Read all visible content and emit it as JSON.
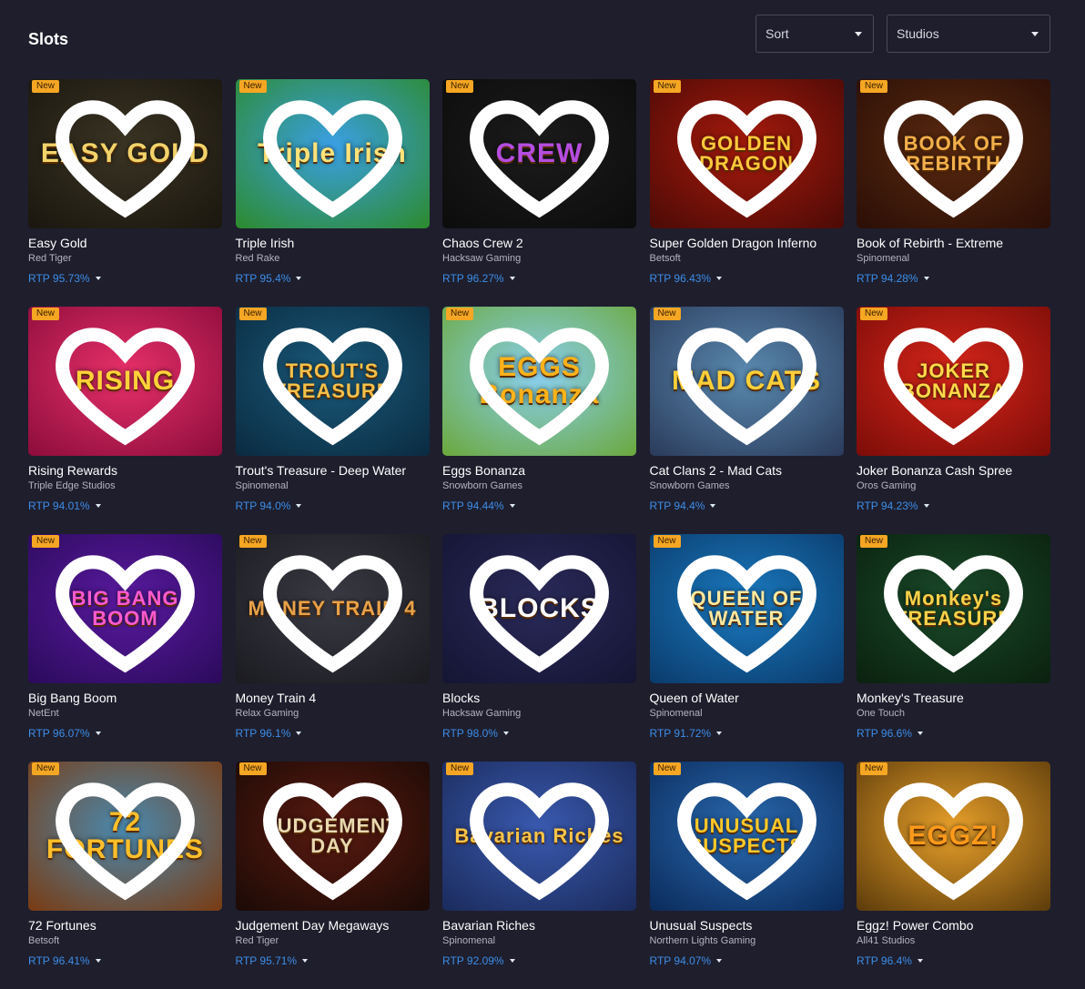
{
  "page": {
    "title": "Slots"
  },
  "filters": {
    "sort_label": "Sort",
    "studios_label": "Studios"
  },
  "badge_label": "New",
  "games": [
    {
      "name": "Easy Gold",
      "provider": "Red Tiger",
      "rtp": "RTP 95.73%",
      "new": true,
      "art": "EASY GOLD",
      "bg": [
        "#3a3424",
        "#1a160e"
      ],
      "art_color": "#f2d36b"
    },
    {
      "name": "Triple Irish",
      "provider": "Red Rake",
      "rtp": "RTP 95.4%",
      "new": true,
      "art": "Triple Irish",
      "bg": [
        "#3aa0e6",
        "#2c8a2a"
      ],
      "art_color": "#ffe27a"
    },
    {
      "name": "Chaos Crew 2",
      "provider": "Hacksaw Gaming",
      "rtp": "RTP 96.27%",
      "new": true,
      "art": "CREW",
      "bg": [
        "#1b1b1b",
        "#0c0c0c"
      ],
      "art_color": "#b54de0"
    },
    {
      "name": "Super Golden Dragon Inferno",
      "provider": "Betsoft",
      "rtp": "RTP 96.43%",
      "new": true,
      "art": "GOLDEN DRAGON",
      "bg": [
        "#a81a0c",
        "#4a0a06"
      ],
      "art_color": "#ffc83a"
    },
    {
      "name": "Book of Rebirth - Extreme",
      "provider": "Spinomenal",
      "rtp": "RTP 94.28%",
      "new": true,
      "art": "BOOK OF REBIRTH",
      "bg": [
        "#5a2a10",
        "#2a0e06"
      ],
      "art_color": "#f2b04a"
    },
    {
      "name": "Rising Rewards",
      "provider": "Triple Edge Studios",
      "rtp": "RTP 94.01%",
      "new": true,
      "art": "RISING",
      "bg": [
        "#e8306a",
        "#8a0c3a"
      ],
      "art_color": "#ffd23a"
    },
    {
      "name": "Trout's Treasure - Deep Water",
      "provider": "Spinomenal",
      "rtp": "RTP 94.0%",
      "new": true,
      "art": "TROUT'S TREASURE",
      "bg": [
        "#1a5a7a",
        "#0a2a40"
      ],
      "art_color": "#f4c04a"
    },
    {
      "name": "Eggs Bonanza",
      "provider": "Snowborn Games",
      "rtp": "RTP 94.44%",
      "new": true,
      "art": "EGGS Bonanza",
      "bg": [
        "#8ad0f2",
        "#6aa83a"
      ],
      "art_color": "#ffb21a"
    },
    {
      "name": "Cat Clans 2 - Mad Cats",
      "provider": "Snowborn Games",
      "rtp": "RTP 94.4%",
      "new": true,
      "art": "MAD CATS",
      "bg": [
        "#5a8ab0",
        "#2a3a5a"
      ],
      "art_color": "#ffcf3a"
    },
    {
      "name": "Joker Bonanza Cash Spree",
      "provider": "Oros Gaming",
      "rtp": "RTP 94.23%",
      "new": true,
      "art": "JOKER BONANZA",
      "bg": [
        "#d8261a",
        "#7a0c08"
      ],
      "art_color": "#ffd94a"
    },
    {
      "name": "Big Bang Boom",
      "provider": "NetEnt",
      "rtp": "RTP 96.07%",
      "new": true,
      "art": "BIG BANG BOOM",
      "bg": [
        "#5a1aa0",
        "#2a0a5a"
      ],
      "art_color": "#ff5ad2"
    },
    {
      "name": "Money Train 4",
      "provider": "Relax Gaming",
      "rtp": "RTP 96.1%",
      "new": true,
      "art": "MONEY TRAIN 4",
      "bg": [
        "#3a3a44",
        "#1a1a20"
      ],
      "art_color": "#e8a24a"
    },
    {
      "name": "Blocks",
      "provider": "Hacksaw Gaming",
      "rtp": "RTP 98.0%",
      "new": false,
      "art": "BLOCKS",
      "bg": [
        "#2a2a5a",
        "#141432"
      ],
      "art_color": "#ffffff"
    },
    {
      "name": "Queen of Water",
      "provider": "Spinomenal",
      "rtp": "RTP 91.72%",
      "new": true,
      "art": "QUEEN OF WATER",
      "bg": [
        "#1a7ac0",
        "#0a3a6a"
      ],
      "art_color": "#ffe8a0"
    },
    {
      "name": "Monkey's Treasure",
      "provider": "One Touch",
      "rtp": "RTP 96.6%",
      "new": true,
      "art": "Monkey's TREASURE",
      "bg": [
        "#1a4a2a",
        "#0a200e"
      ],
      "art_color": "#f6d24a"
    },
    {
      "name": "72 Fortunes",
      "provider": "Betsoft",
      "rtp": "RTP 96.41%",
      "new": true,
      "art": "72 FORTUNES",
      "bg": [
        "#4a8ab0",
        "#7a3a10"
      ],
      "art_color": "#ffbf2a"
    },
    {
      "name": "Judgement Day Megaways",
      "provider": "Red Tiger",
      "rtp": "RTP 95.71%",
      "new": true,
      "art": "JUDGEMENT DAY",
      "bg": [
        "#5a1a10",
        "#1a0a06"
      ],
      "art_color": "#e8d8b0"
    },
    {
      "name": "Bavarian Riches",
      "provider": "Spinomenal",
      "rtp": "RTP 92.09%",
      "new": true,
      "art": "Bavarian Riches",
      "bg": [
        "#3a5ab0",
        "#1a2a5a"
      ],
      "art_color": "#f6c44a"
    },
    {
      "name": "Unusual Suspects",
      "provider": "Northern Lights Gaming",
      "rtp": "RTP 94.07%",
      "new": true,
      "art": "UNUSUAL SUSPECTS",
      "bg": [
        "#2a6ab0",
        "#0a2a5a"
      ],
      "art_color": "#ffc82a"
    },
    {
      "name": "Eggz! Power Combo",
      "provider": "All41 Studios",
      "rtp": "RTP 96.4%",
      "new": true,
      "art": "EGGZ!",
      "bg": [
        "#e8a02a",
        "#5a3a0a"
      ],
      "art_color": "#ff9a1a"
    }
  ]
}
